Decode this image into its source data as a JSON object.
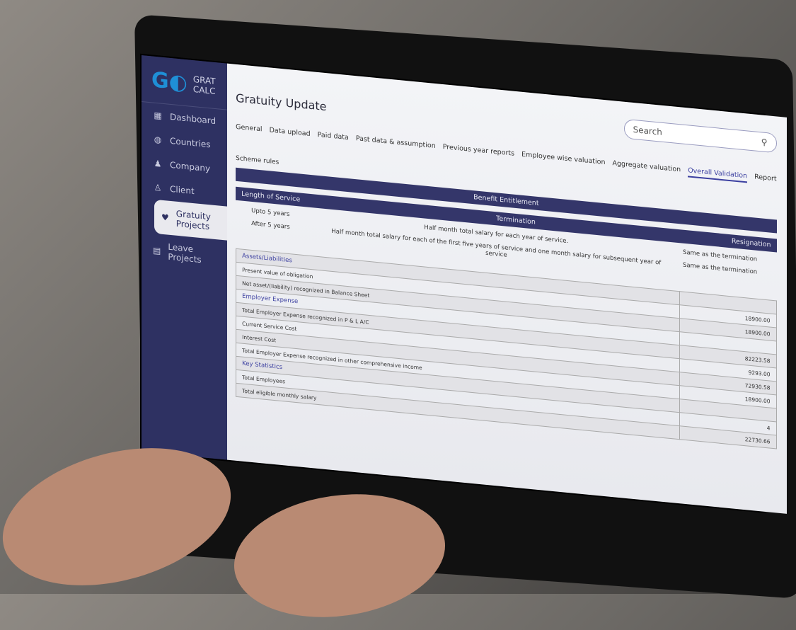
{
  "app": {
    "logo_text": "GRAT CALC",
    "logo_mark": "G"
  },
  "sidebar": {
    "items": [
      {
        "label": "Dashboard",
        "icon": "grid-icon",
        "active": false
      },
      {
        "label": "Countries",
        "icon": "globe-icon",
        "active": false
      },
      {
        "label": "Company",
        "icon": "person-icon",
        "active": false
      },
      {
        "label": "Client",
        "icon": "client-icon",
        "active": false
      },
      {
        "label": "Gratuity Projects",
        "icon": "heart-icon",
        "active": true
      },
      {
        "label": "Leave Projects",
        "icon": "calendar-icon",
        "active": false
      }
    ]
  },
  "header": {
    "title": "Gratuity Update",
    "search_placeholder": "Search"
  },
  "tabs": [
    "General",
    "Data upload",
    "Paid data",
    "Past data & assumption",
    "Previous year reports",
    "Employee wise valuation",
    "Aggregate valuation",
    "Overall Validation",
    "Report"
  ],
  "active_tab": "Overall Validation",
  "scheme": {
    "label": "Scheme rules",
    "benefit_header": "Benefit Entitlement",
    "col_service": "Length of Service",
    "col_termination": "Termination",
    "col_resignation": "Resignation",
    "rows": [
      {
        "service": "Upto 5 years",
        "termination": "Half month total salary for each year of service.",
        "resignation": "Same as the termination"
      },
      {
        "service": "After 5 years",
        "termination": "Half month total salary for each of the first five years of service and one month salary for subsequent year of service",
        "resignation": "Same as the termination"
      }
    ]
  },
  "summary": [
    {
      "label": "Assets/Liabilities",
      "header": true,
      "value": ""
    },
    {
      "label": "Present value of obligation",
      "value": "18900.00"
    },
    {
      "label": "Net asset/(liability) recognized in Balance Sheet",
      "value": "18900.00"
    },
    {
      "label": "Employer Expense",
      "header": true,
      "value": ""
    },
    {
      "label": "Total Employer Expense recognized in P & L A/C",
      "value": "82223.58"
    },
    {
      "label": "Current Service Cost",
      "value": "9293.00"
    },
    {
      "label": "Interest Cost",
      "value": "72930.58"
    },
    {
      "label": "Total Employer Expense recognized in other comprehensive income",
      "value": "18900.00"
    },
    {
      "label": "Key Statistics",
      "header": true,
      "value": ""
    },
    {
      "label": "Total Employees",
      "value": "4"
    },
    {
      "label": "Total eligible monthly salary",
      "value": "22730.66"
    }
  ],
  "colors": {
    "sidebar": "#2e3162",
    "accent": "#3b3fa0",
    "logo_blue": "#1f8fd6"
  }
}
